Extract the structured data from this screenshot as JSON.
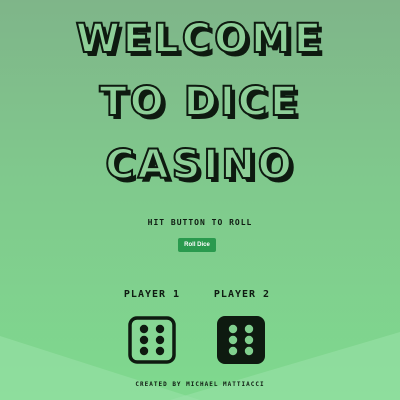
{
  "title": {
    "line1": "WELCOME",
    "line2": "TO DICE",
    "line3": "CASINO"
  },
  "subtitle": "HIT BUTTON TO ROLL",
  "roll_button": {
    "label": "Roll Dice"
  },
  "players": [
    {
      "label": "PLAYER 1",
      "die_value": 6,
      "die_style": "outline"
    },
    {
      "label": "PLAYER 2",
      "die_value": 6,
      "die_style": "filled"
    }
  ],
  "footer": "CREATED BY MICHAEL MATTIACCI",
  "colors": {
    "background_top": "#7fb589",
    "background_bottom": "#7fd98e",
    "button": "#2a9a4e",
    "text": "#0f1c12"
  }
}
